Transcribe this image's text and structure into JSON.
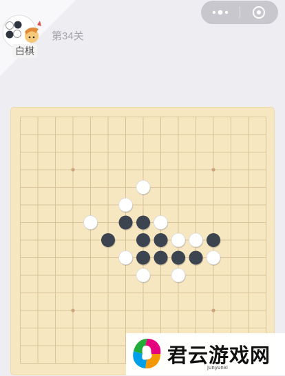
{
  "header": {
    "player_label": "白棋",
    "level_text": "第34关"
  },
  "capsule": {
    "more_icon": "more-dots-icon",
    "close_icon": "target-circle-icon"
  },
  "board": {
    "lines": 15,
    "star_points": [
      [
        3,
        3
      ],
      [
        3,
        11
      ],
      [
        11,
        3
      ],
      [
        11,
        11
      ],
      [
        7,
        7
      ]
    ],
    "stones": [
      {
        "color": "white",
        "col": 7,
        "row": 4
      },
      {
        "color": "white",
        "col": 6,
        "row": 5
      },
      {
        "color": "white",
        "col": 4,
        "row": 6
      },
      {
        "color": "black",
        "col": 6,
        "row": 6
      },
      {
        "color": "black",
        "col": 7,
        "row": 6
      },
      {
        "color": "white",
        "col": 8,
        "row": 6
      },
      {
        "color": "black",
        "col": 5,
        "row": 7
      },
      {
        "color": "black",
        "col": 7,
        "row": 7
      },
      {
        "color": "black",
        "col": 8,
        "row": 7
      },
      {
        "color": "white",
        "col": 9,
        "row": 7
      },
      {
        "color": "white",
        "col": 10,
        "row": 7
      },
      {
        "color": "black",
        "col": 11,
        "row": 7
      },
      {
        "color": "white",
        "col": 6,
        "row": 8
      },
      {
        "color": "black",
        "col": 7,
        "row": 8
      },
      {
        "color": "black",
        "col": 8,
        "row": 8
      },
      {
        "color": "black",
        "col": 9,
        "row": 8
      },
      {
        "color": "black",
        "col": 10,
        "row": 8
      },
      {
        "color": "white",
        "col": 11,
        "row": 8
      },
      {
        "color": "white",
        "col": 7,
        "row": 9
      },
      {
        "color": "white",
        "col": 9,
        "row": 9
      }
    ]
  },
  "watermark": {
    "text": "君云游戏网",
    "domain": "junyunxi"
  },
  "colors": {
    "board": "#f6e7c1",
    "grid": "#d8c39a",
    "black_stone": "#3c4450",
    "white_stone": "#ffffff"
  }
}
